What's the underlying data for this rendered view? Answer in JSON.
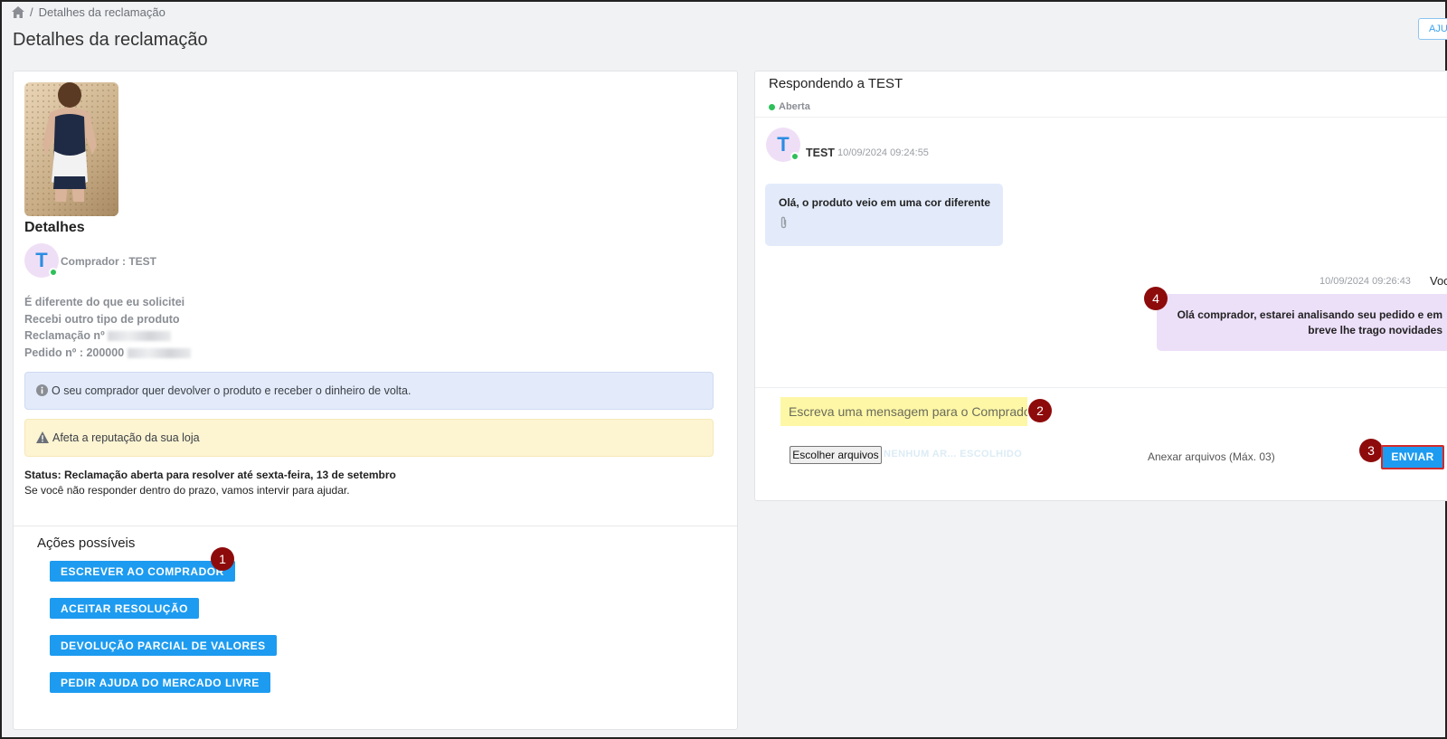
{
  "breadcrumb": {
    "current": "Detalhes da reclamação"
  },
  "page_title": "Detalhes da reclamação",
  "header": {
    "help_label": "AJU"
  },
  "left": {
    "details_heading": "Detalhes",
    "buyer": {
      "avatar_letter": "T",
      "label": "Comprador : TEST"
    },
    "claim": {
      "reason": "É diferente do que eu solicitei",
      "detail": "Recebi outro tipo de produto",
      "claim_number_label": "Reclamação nº",
      "order_number_label": "Pedido nº : 200000"
    },
    "info_alert": "O seu comprador quer devolver o produto e receber o dinheiro de volta.",
    "warning_alert": "Afeta a reputação da sua loja",
    "status_bold": "Status: Reclamação aberta para resolver até sexta-feira, 13 de setembro",
    "status_note": "Se você não responder dentro do prazo, vamos intervir para ajudar.",
    "actions_title": "Ações possíveis",
    "actions": [
      {
        "label": "ESCREVER AO COMPRADOR"
      },
      {
        "label": "ACEITAR RESOLUÇÃO"
      },
      {
        "label": "DEVOLUÇÃO PARCIAL DE VALORES"
      },
      {
        "label": "PEDIR AJUDA DO MERCADO LIVRE"
      }
    ]
  },
  "right": {
    "responding_title": "Respondendo a TEST",
    "status": "Aberta",
    "messages": [
      {
        "avatar_letter": "T",
        "author": "TEST",
        "time": "10/09/2024 09:24:55",
        "text": "Olá, o produto veio em uma cor diferente"
      },
      {
        "author": "Voc",
        "time": "10/09/2024 09:26:43",
        "text_line1": "Olá comprador, estarei analisando seu pedido e em",
        "text_line2": "breve lhe trago novidades"
      }
    ],
    "composer": {
      "placeholder": "Escreva uma mensagem para o Comprador",
      "file_button": "Escolher arquivos",
      "file_name": "NENHUM AR... ESCOLHIDO",
      "attach_label": "Anexar arquivos (Máx. 03)",
      "send_label": "ENVIAR"
    }
  },
  "markers": [
    "1",
    "2",
    "3",
    "4"
  ],
  "colors": {
    "primary": "#1d9bf0",
    "marker": "#8e0b0b",
    "online": "#2ec05a",
    "info_bg": "#e3ebfb",
    "warning_bg": "#fdf4d2",
    "outgoing_bubble": "#ecdff8",
    "input_highlight": "#fdf7a6"
  }
}
